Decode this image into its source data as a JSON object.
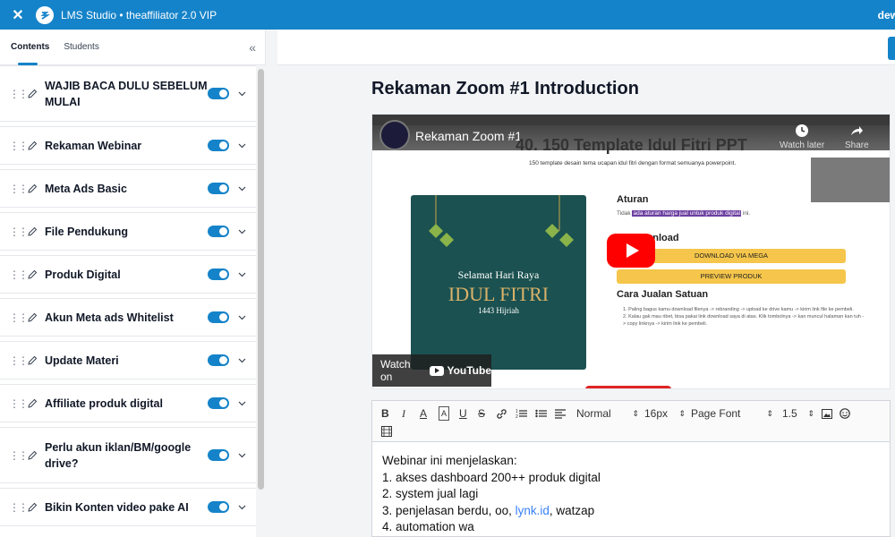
{
  "topbar": {
    "close_icon": "close-icon",
    "title": "LMS Studio • theaffiliator 2.0 VIP",
    "user": "dew"
  },
  "sidebar": {
    "tabs": [
      {
        "label": "Contents",
        "active": true
      },
      {
        "label": "Students",
        "active": false
      }
    ],
    "items": [
      {
        "label": "WAJIB BACA DULU SEBELUM MULAI",
        "enabled": true
      },
      {
        "label": "Rekaman Webinar",
        "enabled": true
      },
      {
        "label": "Meta Ads Basic",
        "enabled": true
      },
      {
        "label": "File Pendukung",
        "enabled": true
      },
      {
        "label": "Produk Digital",
        "enabled": true
      },
      {
        "label": "Akun Meta ads Whitelist",
        "enabled": true
      },
      {
        "label": "Update Materi",
        "enabled": true
      },
      {
        "label": "Affiliate produk digital",
        "enabled": true
      },
      {
        "label": "Perlu akun iklan/BM/google drive?",
        "enabled": true
      },
      {
        "label": "Bikin Konten video pake AI",
        "enabled": true
      }
    ]
  },
  "main": {
    "lesson_title": "Rekaman Zoom #1 Introduction",
    "video": {
      "title": "Rekaman Zoom #1",
      "slide_heading": "40. 150 Template Idul Fitri PPT",
      "slide_subtitle": "150 template desain tema ucapan idul fitri dengan format semuanya powerpoint.",
      "watch_later": "Watch later",
      "share": "Share",
      "card_line1": "Selamat Hari Raya",
      "card_line2": "IDUL FITRI",
      "card_line3": "1443 Hijriah",
      "aturan_heading": "Aturan",
      "aturan_prefix": "Tidak",
      "aturan_highlight": "ada aturan harga jual untuk produk digital",
      "aturan_suffix": "ini.",
      "download_heading": "Download",
      "btn_mega": "DOWNLOAD VIA MEGA",
      "btn_preview": "PREVIEW PRODUK",
      "cara_heading": "Cara Jualan Satuan",
      "step1": "1. Paling bagus kamu download filenya -> rebranding -> upload ke drive kamu -> kirim link file ke pembeli.",
      "step2": "2. Kalau gak mau ribet, bisa pakai link download saya di atas. Klik tombolnya -> kan muncul halaman kan tuh -> copy linknya -> kirim link ke pembeli.",
      "watch_on": "Watch on",
      "youtube": "YouTube"
    },
    "editor": {
      "format": "Normal",
      "size": "16px",
      "font": "Page Font",
      "line_height": "1.5",
      "lines": [
        "Webinar ini menjelaskan:",
        "1. akses dashboard 200++ produk digital",
        "2. system jual lagi"
      ],
      "line3_prefix": "3. penjelasan berdu, oo, ",
      "line3_link": "lynk.id",
      "line3_suffix": ", watzap",
      "line4": "4. automation wa"
    }
  },
  "colors": {
    "brand": "#1583c9",
    "play": "#ff0000",
    "button_yellow": "#f5c64b"
  }
}
